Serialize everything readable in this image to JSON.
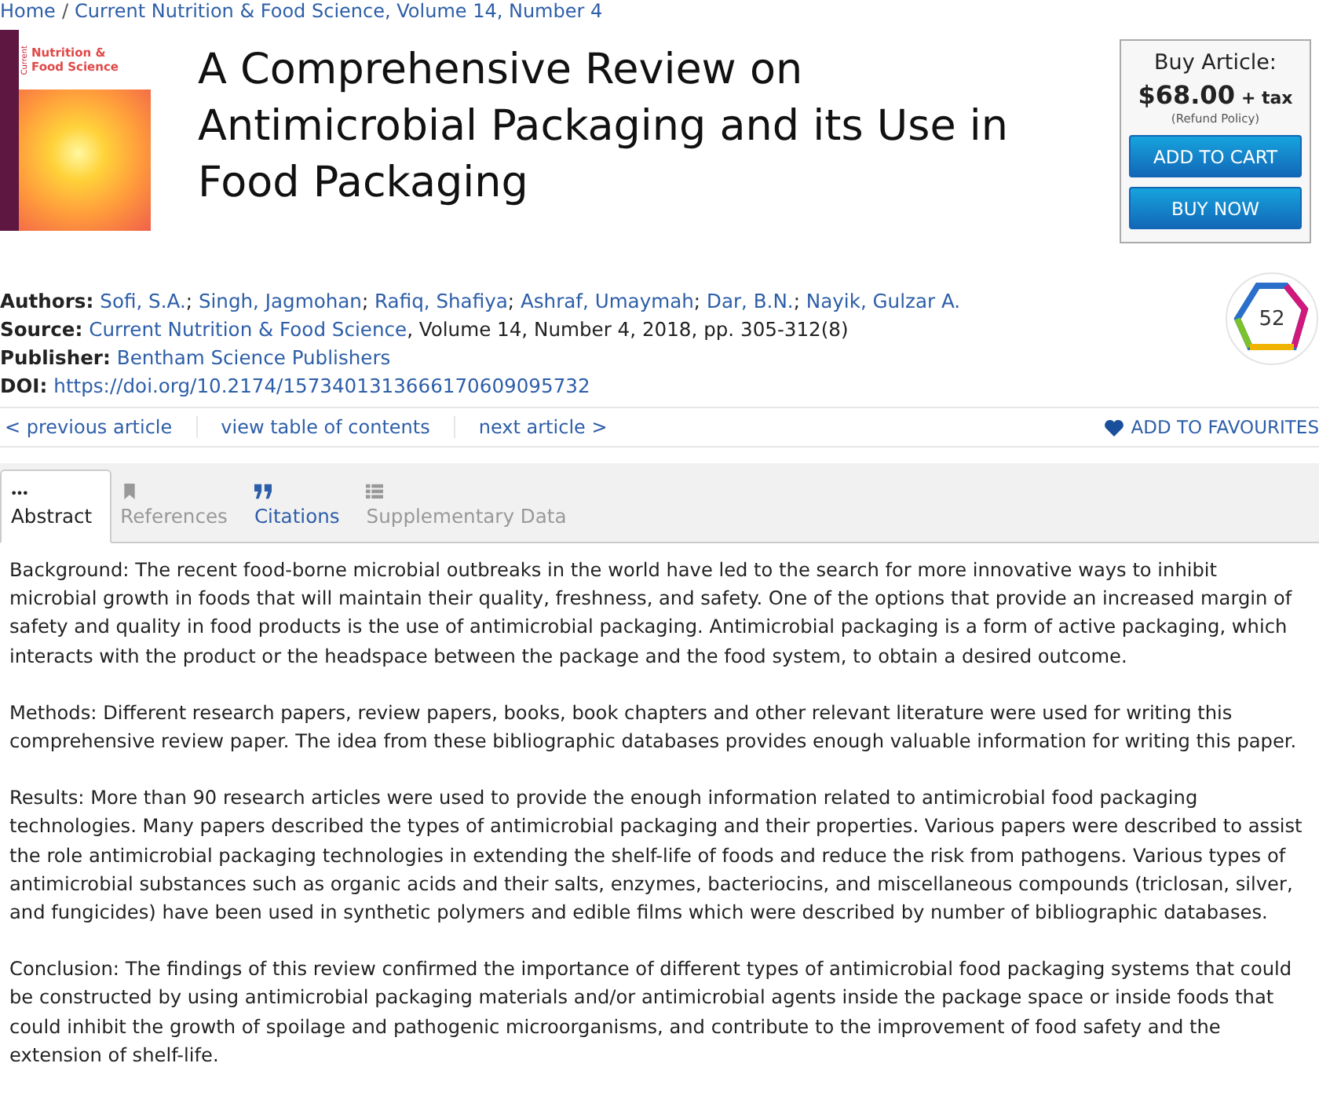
{
  "breadcrumb": {
    "separator": "/",
    "items": [
      {
        "text": "Home"
      },
      {
        "text": "Current Nutrition & Food Science, Volume 14, Number 4"
      }
    ]
  },
  "cover": {
    "journal_line1": "Nutrition &",
    "journal_line2": "Food Science",
    "journal_vertical": "Current"
  },
  "title": "A Comprehensive Review on Antimicrobial Packaging and its Use in Food Packaging",
  "buy": {
    "heading": "Buy Article:",
    "price": "$68.00",
    "tax": "+ tax",
    "refund": "(Refund Policy)",
    "buttons": [
      "ADD TO CART",
      "BUY NOW"
    ]
  },
  "altmetric": {
    "score": "52"
  },
  "meta": [
    {
      "label": "Authors:",
      "parts": [
        {
          "text": "Sofi, S.A.",
          "link": true
        },
        {
          "text": "; ",
          "link": false
        },
        {
          "text": "Singh, Jagmohan",
          "link": true
        },
        {
          "text": "; ",
          "link": false
        },
        {
          "text": "Rafiq, Shafiya",
          "link": true
        },
        {
          "text": "; ",
          "link": false
        },
        {
          "text": "Ashraf, Umaymah",
          "link": true
        },
        {
          "text": "; ",
          "link": false
        },
        {
          "text": "Dar, B.N.",
          "link": true
        },
        {
          "text": "; ",
          "link": false
        },
        {
          "text": "Nayik, Gulzar A.",
          "link": true
        }
      ]
    },
    {
      "label": "Source:",
      "parts": [
        {
          "text": "Current Nutrition & Food Science",
          "link": true
        },
        {
          "text": ", Volume 14, Number 4, 2018, pp. 305-312(8)",
          "link": false
        }
      ]
    },
    {
      "label": "Publisher:",
      "parts": [
        {
          "text": "Bentham Science Publishers",
          "link": true
        }
      ]
    },
    {
      "label": "DOI:",
      "parts": [
        {
          "text": "https://doi.org/10.2174/1573401313666170609095732",
          "link": true
        }
      ]
    }
  ],
  "nav": [
    "< previous article",
    "view table of contents",
    "next article >"
  ],
  "favourites": "ADD TO FAVOURITES",
  "tabs": [
    {
      "label": "Abstract",
      "kind": "dots",
      "selected": true,
      "disabled": false
    },
    {
      "label": "References",
      "kind": "bookmark",
      "selected": false,
      "disabled": true
    },
    {
      "label": "Citations",
      "kind": "quote",
      "selected": false,
      "disabled": false
    },
    {
      "label": "Supplementary Data",
      "kind": "list",
      "selected": false,
      "disabled": true
    }
  ],
  "abstract": [
    "Background: The recent food-borne microbial outbreaks in the world have led to the search for more innovative ways to inhibit microbial growth in foods that will maintain their quality, freshness, and safety. One of the options that provide an increased margin of safety and quality in food products is the use of antimicrobial packaging. Antimicrobial packaging is a form of active packaging, which interacts with the product or the headspace between the package and the food system, to obtain a desired outcome.",
    "Methods: Different research papers, review papers, books, book chapters and other relevant literature were used for writing this comprehensive review paper. The idea from these bibliographic databases provides enough valuable information for writing this paper.",
    "Results: More than 90 research articles were used to provide the enough information related to antimicrobial food packaging technologies. Many papers described the types of antimicrobial packaging and their properties. Various papers were described to assist the role antimicrobial packaging technologies in extending the shelf-life of foods and reduce the risk from pathogens. Various types of antimicrobial substances such as organic acids and their salts, enzymes, bacteriocins, and miscellaneous compounds (triclosan, silver, and fungicides) have been used in synthetic polymers and edible films which were described by number of bibliographic databases.",
    "Conclusion: The findings of this review confirmed the importance of different types of antimicrobial food packaging systems that could be constructed by using antimicrobial packaging materials and/or antimicrobial agents inside the package space or inside foods that could inhibit the growth of spoilage and pathogenic microorganisms, and contribute to the improvement of food safety and the extension of shelf-life."
  ]
}
